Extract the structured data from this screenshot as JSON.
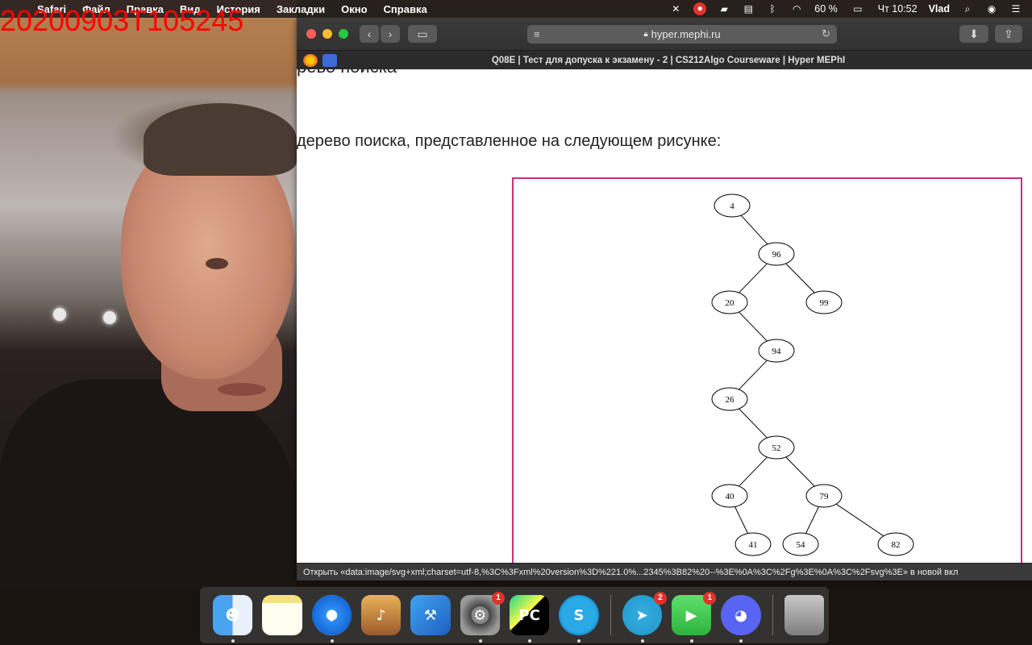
{
  "overlay": {
    "timestamp": "20200903T105245"
  },
  "menubar": {
    "app": "Safari",
    "menus": [
      "Файл",
      "Правка",
      "Вид",
      "История",
      "Закладки",
      "Окно",
      "Справка"
    ],
    "status": {
      "battery": "60 %",
      "clock": "Чт 10:52",
      "user": "Vlad"
    }
  },
  "browser": {
    "url": "hyper.mephi.ru",
    "tab_title": "Q08E | Тест для допуска к экзамену - 2 | CS212Algo Courseware | Hyper MEPhI",
    "status_text": "Открыть «data:image/svg+xml;charset=utf-8,%3C%3Fxml%20version%3D%221.0%...2345%3B82%20--%3E%0A%3C%2Fg%3E%0A%3C%2Fsvg%3E» в новой вкл"
  },
  "content": {
    "cut_heading": "рево поиска",
    "question": "дерево поиска, представленное на следующем рисунке:"
  },
  "tree": {
    "nodes": [
      {
        "id": "4",
        "label": "4"
      },
      {
        "id": "96",
        "label": "96"
      },
      {
        "id": "20",
        "label": "20"
      },
      {
        "id": "99",
        "label": "99"
      },
      {
        "id": "94",
        "label": "94"
      },
      {
        "id": "26",
        "label": "26"
      },
      {
        "id": "52",
        "label": "52"
      },
      {
        "id": "40",
        "label": "40"
      },
      {
        "id": "79",
        "label": "79"
      },
      {
        "id": "41",
        "label": "41"
      },
      {
        "id": "54",
        "label": "54"
      },
      {
        "id": "82",
        "label": "82"
      }
    ],
    "edges": [
      [
        "4",
        "96"
      ],
      [
        "96",
        "20"
      ],
      [
        "96",
        "99"
      ],
      [
        "20",
        "94"
      ],
      [
        "94",
        "26"
      ],
      [
        "26",
        "52"
      ],
      [
        "52",
        "40"
      ],
      [
        "52",
        "79"
      ],
      [
        "40",
        "41"
      ],
      [
        "79",
        "54"
      ],
      [
        "79",
        "82"
      ]
    ]
  },
  "dock": {
    "apps": [
      {
        "name": "finder",
        "badge": ""
      },
      {
        "name": "notes",
        "badge": ""
      },
      {
        "name": "safari",
        "badge": ""
      },
      {
        "name": "garageband",
        "badge": ""
      },
      {
        "name": "xcode",
        "badge": ""
      },
      {
        "name": "system-preferences",
        "badge": "1"
      },
      {
        "name": "pycharm",
        "badge": ""
      },
      {
        "name": "skype",
        "badge": ""
      },
      {
        "name": "telegram",
        "badge": "2"
      },
      {
        "name": "facetime",
        "badge": "1"
      },
      {
        "name": "discord",
        "badge": ""
      },
      {
        "name": "trash",
        "badge": ""
      }
    ]
  }
}
